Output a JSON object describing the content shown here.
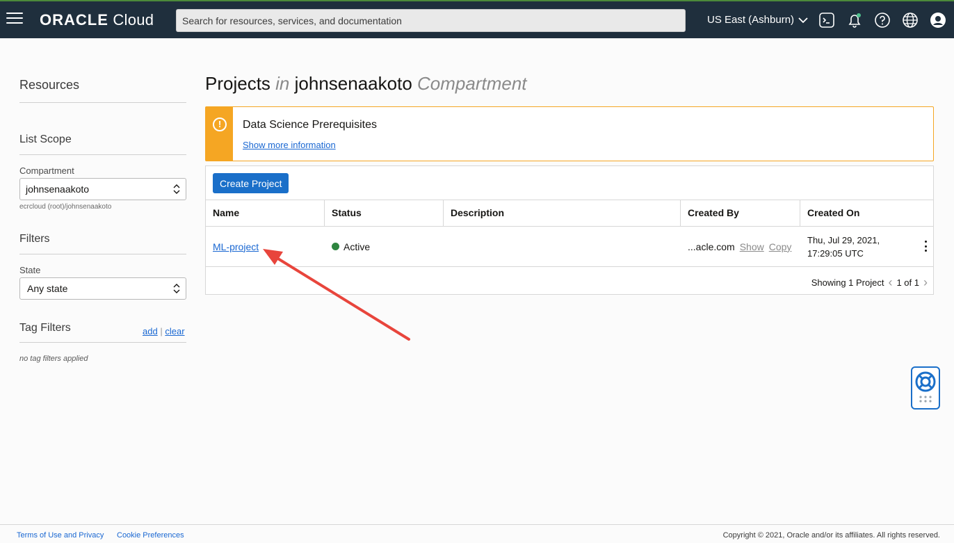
{
  "header": {
    "brand": "ORACLE",
    "product": "Cloud",
    "search_placeholder": "Search for resources, services, and documentation",
    "region": "US East (Ashburn)"
  },
  "sidebar": {
    "resources_title": "Resources",
    "list_scope_title": "List Scope",
    "compartment_label": "Compartment",
    "compartment_value": "johnsenaakoto",
    "compartment_path": "ecrcloud (root)/johnsenaakoto",
    "filters_title": "Filters",
    "state_label": "State",
    "state_value": "Any state",
    "tag_filters_title": "Tag Filters",
    "tag_add": "add",
    "tag_sep": "|",
    "tag_clear": "clear",
    "no_tags": "no tag filters applied"
  },
  "main": {
    "title_prefix": "Projects",
    "title_in": "in",
    "title_compartment": "johnsenaakoto",
    "title_suffix": "Compartment",
    "alert_icon": "!",
    "alert_title": "Data Science Prerequisites",
    "alert_link": "Show more information",
    "create_button": "Create Project",
    "columns": [
      "Name",
      "Status",
      "Description",
      "Created By",
      "Created On"
    ],
    "rows": [
      {
        "name": "ML-project",
        "status": "Active",
        "description": "",
        "created_by": "...acle.com",
        "show": "Show",
        "copy": "Copy",
        "created_on_line1": "Thu, Jul 29, 2021,",
        "created_on_line2": "17:29:05 UTC"
      }
    ],
    "pager_text": "Showing 1 Project",
    "pager_page": "1 of 1"
  },
  "footer": {
    "terms": "Terms of Use and Privacy",
    "cookies": "Cookie Preferences",
    "copyright": "Copyright © 2021, Oracle and/or its affiliates. All rights reserved."
  },
  "colors": {
    "topbar": "#1f2f3d",
    "accent": "#1a6fc9",
    "warning": "#f5a623",
    "active": "#2e8540",
    "annotation_arrow": "#e8453c"
  },
  "icons": [
    "hamburger-menu-icon",
    "chevron-down-icon",
    "cloud-shell-icon",
    "bell-icon",
    "help-icon",
    "globe-icon",
    "user-avatar-icon",
    "warning-icon",
    "sort-arrows-icon",
    "kebab-menu-icon",
    "chevron-left-icon",
    "chevron-right-icon",
    "lifebuoy-icon"
  ]
}
